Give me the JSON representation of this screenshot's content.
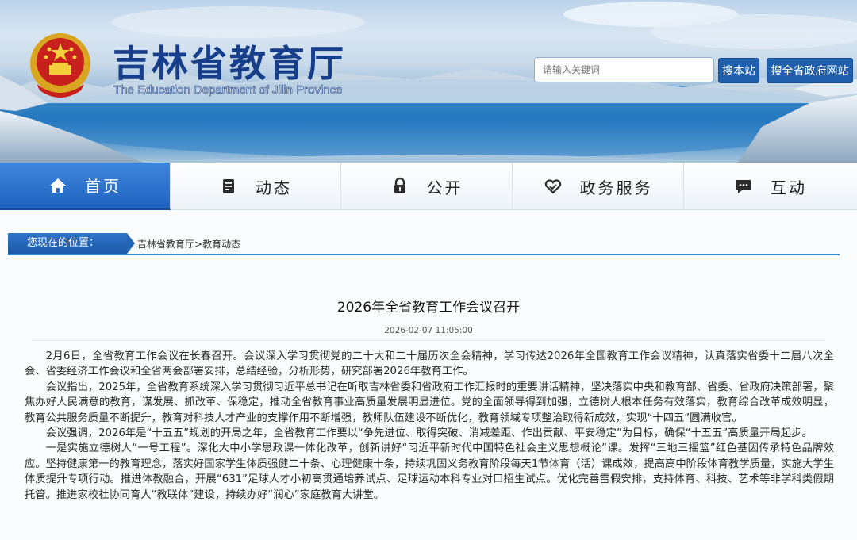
{
  "header": {
    "title": "吉林省教育厅",
    "subtitle": "The Education Department of Jilin Province",
    "search_placeholder": "请输入关键词",
    "search_site_label": "搜本站",
    "search_gov_label": "搜全省政府网站"
  },
  "nav": {
    "items": [
      {
        "label": "首页",
        "icon": "home-icon",
        "active": true
      },
      {
        "label": "动态",
        "icon": "document-icon",
        "active": false
      },
      {
        "label": "公开",
        "icon": "lock-icon",
        "active": false
      },
      {
        "label": "政务服务",
        "icon": "heart-hand-icon",
        "active": false
      },
      {
        "label": "互动",
        "icon": "chat-icon",
        "active": false
      }
    ]
  },
  "breadcrumb": {
    "label": "您现在的位置：",
    "items": [
      "吉林省教育厅",
      "教育动态"
    ],
    "separator": ">"
  },
  "article": {
    "title": "2026年全省教育工作会议召开",
    "date": "2026-02-07 11:05:00",
    "paragraphs": [
      "2月6日，全省教育工作会议在长春召开。会议深入学习贯彻党的二十大和二十届历次全会精神，学习传达2026年全国教育工作会议精神，认真落实省委十二届八次全会、省委经济工作会议和全省两会部署安排，总结经验，分析形势，研究部署2026年教育工作。",
      "会议指出，2025年，全省教育系统深入学习贯彻习近平总书记在听取吉林省委和省政府工作汇报时的重要讲话精神，坚决落实中央和教育部、省委、省政府决策部署，聚焦办好人民满意的教育，谋发展、抓改革、保稳定，推动全省教育事业高质量发展明显进位。党的全面领导得到加强，立德树人根本任务有效落实，教育综合改革成效明显，教育公共服务质量不断提升，教育对科技人才产业的支撑作用不断增强，教师队伍建设不断优化，教育领域专项整治取得新成效，实现“十四五”圆满收官。",
      "会议强调，2026年是“十五五”规划的开局之年，全省教育工作要以“争先进位、取得突破、消减差距、作出贡献、平安稳定”为目标，确保“十五五”高质量开局起步。",
      "一是实施立德树人“一号工程”。深化大中小学思政课一体化改革，创新讲好“习近平新时代中国特色社会主义思想概论”课。发挥“三地三摇篮”红色基因传承特色品牌效应。坚持健康第一的教育理念，落实好国家学生体质强健二十条、心理健康十条，持续巩固义务教育阶段每天1节体育（活）课成效，提高高中阶段体育教学质量，实施大学生体质提升专项行动。推进体教融合，开展“631”足球人才小初高贯通培养试点、足球运动本科专业对口招生试点。优化完善雪假安排，支持体育、科技、艺术等非学科类假期托管。推进家校社协同育人“教联体”建设，持续办好“润心”家庭教育大讲堂。"
    ]
  },
  "colors": {
    "brand_blue": "#1f5fae",
    "nav_active": "#2a6fcb",
    "title_blue": "#173e8a"
  }
}
